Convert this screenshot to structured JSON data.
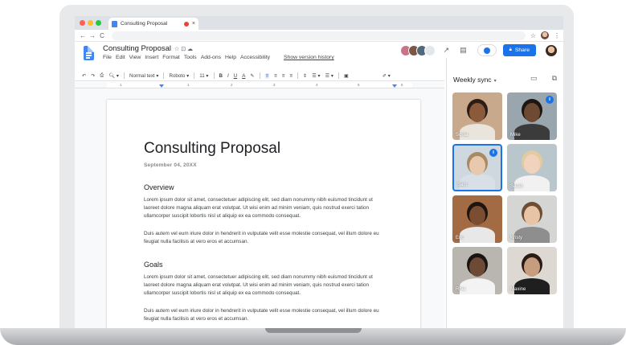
{
  "browser": {
    "tab_title": "Consulting Proposal",
    "tab_close": "×",
    "nav_back": "←",
    "nav_forward": "→",
    "nav_reload": "C",
    "bookmark_icon": "☆",
    "menu_icon": "⋮"
  },
  "docs": {
    "title": "Consulting Proposal",
    "title_icons": "☆ ⊡ ☁",
    "menu": [
      "File",
      "Edit",
      "View",
      "Insert",
      "Format",
      "Tools",
      "Add-ons",
      "Help",
      "Accessibility"
    ],
    "version_history": "Show version history",
    "share_label": "Share",
    "toolbar": {
      "undo": "↶",
      "redo": "↷",
      "print": "⎙",
      "zoom": "🔍︎ ▾",
      "style": "Normal text ▾",
      "font": "Roboto ▾",
      "size": "11 ▾",
      "bold": "B",
      "italic": "I",
      "underline": "U",
      "text_color": "A",
      "highlight": "✎",
      "align_left": "≡",
      "align_center": "≡",
      "align_right": "≡",
      "justify": "≡",
      "line_spacing": "⇕",
      "bullets": "☰ ▾",
      "numbers": "☰ ▾",
      "image": "▣",
      "pen": "✐ ▾"
    },
    "ruler_ticks": [
      "1",
      "1",
      "2",
      "3",
      "4",
      "5",
      "6",
      "7"
    ]
  },
  "document": {
    "heading": "Consulting Proposal",
    "date": "September 04, 20XX",
    "sections": [
      {
        "title": "Overview",
        "paragraphs": [
          "Lorem ipsum dolor sit amet, consectetuer adipiscing elit, sed diam nonummy nibh euismod tincidunt ut laoreet dolore magna aliquam erat volutpat. Ut wisi enim ad minim veniam, quis nostrud exerci tation ullamcorper suscipit lobortis nisl ut aliquip ex ea commodo consequat.",
          "Duis autem vel eum iriure dolor in hendrerit in vulputate velit esse molestie consequat, vel illum dolore eu feugiat nulla facilisis at vero eros et accumsan."
        ]
      },
      {
        "title": "Goals",
        "paragraphs": [
          "Lorem ipsum dolor sit amet, consectetuer adipiscing elit, sed diam nonummy nibh euismod tincidunt ut laoreet dolore magna aliquam erat volutpat. Ut wisi enim ad minim veniam, quis nostrud exerci tation ullamcorper suscipit lobortis nisl ut aliquip ex ea commodo consequat.",
          "Duis autem vel eum iriure dolor in hendrerit in vulputate velit esse molestie consequat, vel illum dolore eu feugiat nulla facilisis at vero eros et accumsan."
        ]
      }
    ]
  },
  "meet": {
    "title": "Weekly sync",
    "caret": "▾",
    "pip_icon": "▭",
    "popout_icon": "⧉",
    "participants": [
      {
        "name": "Sonia",
        "skin": "#8a5a3b",
        "bg": "#c9a98c",
        "shirt": "#e9e4dc",
        "hair": "#2b1d16",
        "speaking": false,
        "active": false
      },
      {
        "name": "Mike",
        "skin": "#6e4a33",
        "bg": "#9aa6ad",
        "shirt": "#3b3b3b",
        "hair": "#1d1611",
        "speaking": true,
        "active": false
      },
      {
        "name": "Sam",
        "skin": "#e9c9ad",
        "bg": "#cfd8de",
        "shirt": "#d8dfe6",
        "hair": "#a88a64",
        "speaking": true,
        "active": true
      },
      {
        "name": "Sarah",
        "skin": "#f1d3bd",
        "bg": "#b9c7cd",
        "shirt": "#f1f1f1",
        "hair": "#e2cba0",
        "speaking": false,
        "active": false
      },
      {
        "name": "Eric",
        "skin": "#7b4e32",
        "bg": "#a36b43",
        "shirt": "#e8e8e8",
        "hair": "#1e1510",
        "speaking": false,
        "active": false
      },
      {
        "name": "Kristy",
        "skin": "#e7c4a5",
        "bg": "#d5d5d3",
        "shirt": "#8e8e8e",
        "hair": "#6d4d34",
        "speaking": false,
        "active": false
      },
      {
        "name": "Rhia",
        "skin": "#6d4a35",
        "bg": "#b8b6ae",
        "shirt": "#f3f3f3",
        "hair": "#1a1310",
        "speaking": false,
        "active": false
      },
      {
        "name": "Maxine",
        "skin": "#c79d80",
        "bg": "#ded8d2",
        "shirt": "#1f1f1f",
        "hair": "#2a1c15",
        "speaking": false,
        "active": false
      }
    ],
    "controls": {
      "mic": "🎙︎",
      "camera": "▭",
      "present": "⊞",
      "more": "⋮",
      "hangup": "☎︎"
    }
  },
  "colors": {
    "accent": "#1a73e8",
    "hangup": "#ea4335",
    "docs_blue": "#4285f4"
  }
}
